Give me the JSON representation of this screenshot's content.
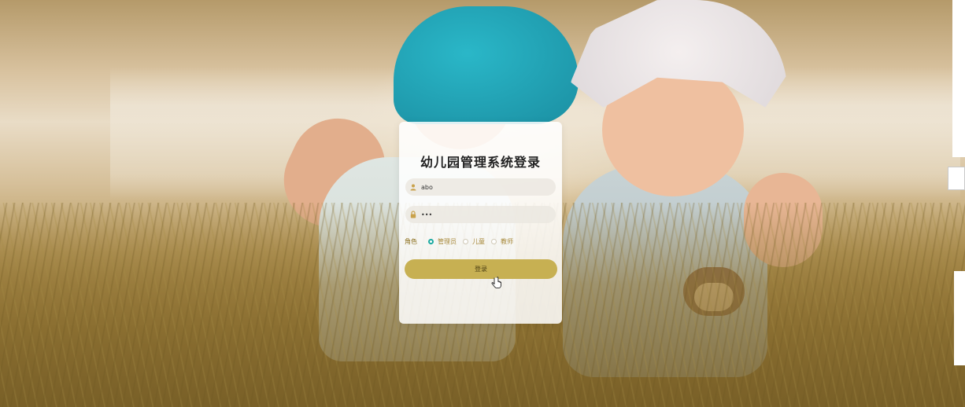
{
  "login": {
    "title": "幼儿园管理系统登录",
    "username": {
      "value": "abo",
      "icon": "user-icon"
    },
    "password": {
      "value": "•••",
      "icon": "lock-icon"
    },
    "role_label": "角色",
    "roles": [
      {
        "label": "管理员",
        "checked": true
      },
      {
        "label": "儿童",
        "checked": false
      },
      {
        "label": "教师",
        "checked": false
      }
    ],
    "submit_label": "登录"
  },
  "colors": {
    "button": "#c7b052",
    "radio_checked": "#1aa9a0",
    "role_text": "#8a6d1a"
  }
}
